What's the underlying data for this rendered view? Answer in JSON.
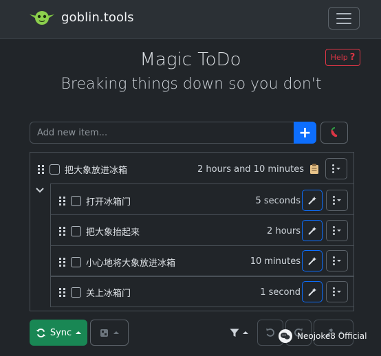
{
  "nav": {
    "brand": "goblin.tools"
  },
  "help": {
    "label": "Help",
    "icon": "?"
  },
  "header": {
    "title": "Magic ToDo",
    "subtitle": "Breaking things down so you don't"
  },
  "add": {
    "placeholder": "Add new item...",
    "plus": "+"
  },
  "tasks": [
    {
      "text": "把大象放进冰箱",
      "estimate": "2 hours and 10 minutes",
      "subtasks": [
        {
          "text": "打开冰箱门",
          "estimate": "5 seconds"
        },
        {
          "text": "把大象抬起来",
          "estimate": "2 hours"
        },
        {
          "text": "小心地将大象放进冰箱",
          "estimate": "10 minutes"
        },
        {
          "text": "关上冰箱门",
          "estimate": "1 second"
        }
      ]
    }
  ],
  "toolbar": {
    "sync_label": "Sync"
  },
  "watermark": {
    "text": "Neojoke8 Official"
  },
  "colors": {
    "primary": "#0d6efd",
    "success": "#198754",
    "danger": "#dc3545",
    "background": "#212529"
  }
}
